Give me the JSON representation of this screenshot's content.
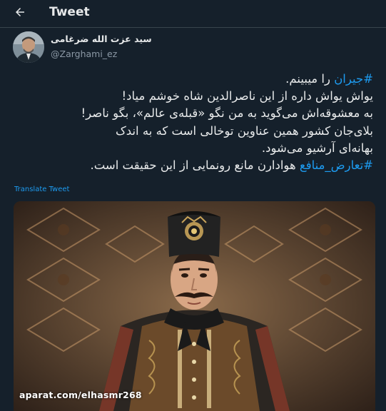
{
  "header": {
    "title": "Tweet",
    "back_icon": "arrow-left-icon"
  },
  "author": {
    "name": "سید عزت الله ضرغامی",
    "handle": "@Zarghami_ez"
  },
  "tweet": {
    "line1_hashtag": "#جیران",
    "line1_rest": " را میبینم.",
    "line2": "یواش یواش داره از این ناصرالدین شاه خوشم میاد!",
    "line3": "به معشوقه‌اش می‌گوید به من نگو «قبله‌ی عالم»، بگو ناصر!",
    "line4": "بلای‌جان کشور همین عناوین توخالی است که به اندک",
    "line5": "بهانه‌ای آرشیو می‌شود.",
    "line6_hashtag": "#تعارض_منافع",
    "line6_rest": " هوادارن مانع رونمایی از این حقیقت است."
  },
  "translate_label": "Translate Tweet",
  "media": {
    "watermark": "aparat.com/elhasmr268"
  },
  "colors": {
    "background": "#15202b",
    "text": "#e7e9ea",
    "secondary": "#8b98a5",
    "accent": "#1d9bf0",
    "divider": "#38444d"
  }
}
